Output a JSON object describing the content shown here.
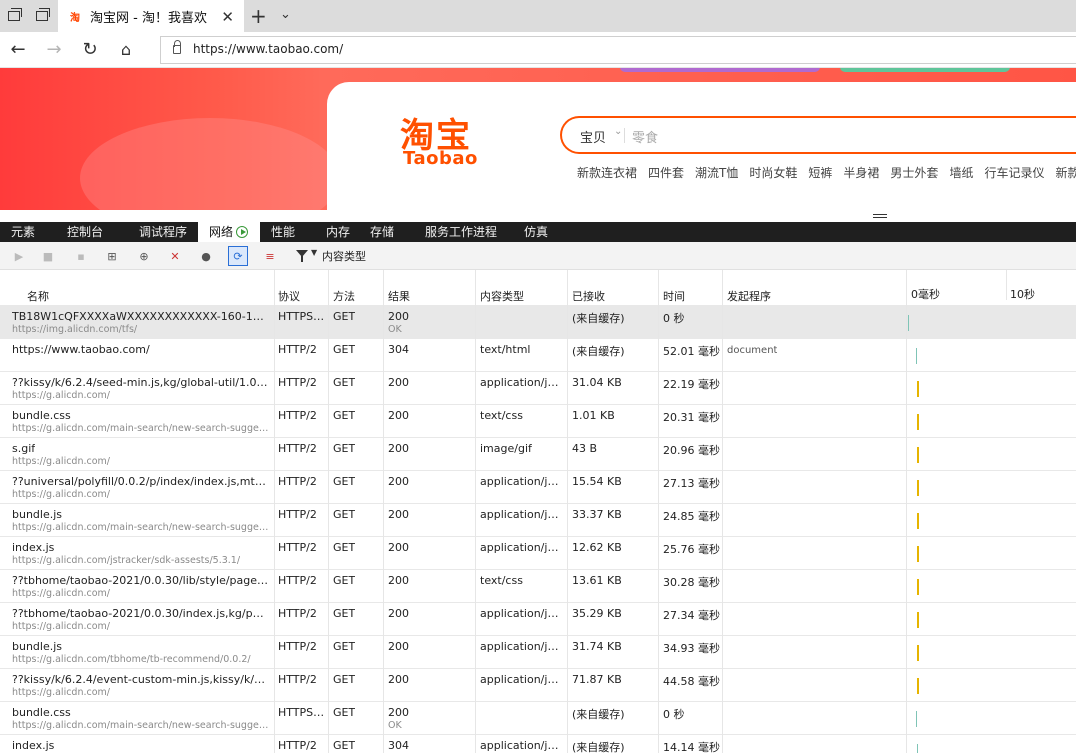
{
  "browser": {
    "tab_title": "淘宝网 - 淘！我喜欢",
    "tab_favicon": "淘",
    "url": "https://www.taobao.com/"
  },
  "page": {
    "logo_cn": "淘宝",
    "logo_en": "Taobao",
    "search_category": "宝贝",
    "search_placeholder": "零食",
    "hotwords": [
      "新款连衣裙",
      "四件套",
      "潮流T恤",
      "时尚女鞋",
      "短裤",
      "半身裙",
      "男士外套",
      "墙纸",
      "行车记录仪",
      "新款男鞋"
    ],
    "brand_color": "#ff5000"
  },
  "devtools": {
    "tabs": [
      "元素",
      "控制台",
      "调试程序",
      "网络",
      "性能",
      "内存",
      "存储",
      "服务工作进程",
      "仿真"
    ],
    "filter_label": "内容类型",
    "columns": {
      "name": "名称",
      "protocol": "协议",
      "method": "方法",
      "result": "结果",
      "content_type": "内容类型",
      "received": "已接收",
      "time": "时间",
      "initiator": "发起程序",
      "wf_0": "0毫秒",
      "wf_10": "10秒"
    },
    "rows": [
      {
        "name": "TB18W1cQFXXXXaWXXXXXXXXXXXX-160-160.png_...",
        "domain": "https://img.alicdn.com/tfs/",
        "protocol": "HTTPS/...",
        "method": "GET",
        "status": "200",
        "status_text": "OK",
        "type": "",
        "received": "(来自缓存)",
        "time": "0 秒",
        "initiator": "",
        "wf_color": "#7fc4b6"
      },
      {
        "name": "https://www.taobao.com/",
        "domain": "",
        "protocol": "HTTP/2",
        "method": "GET",
        "status": "304",
        "status_text": "",
        "type": "text/html",
        "received": "(来自缓存)",
        "time": "52.01 毫秒",
        "initiator": "document",
        "wf_color": "#7fc4b6"
      },
      {
        "name": "??kissy/k/6.2.4/seed-min.js,kg/global-util/1.0.7/inde...",
        "domain": "https://g.alicdn.com/",
        "protocol": "HTTP/2",
        "method": "GET",
        "status": "200",
        "status_text": "",
        "type": "application/java...",
        "received": "31.04 KB",
        "time": "22.19 毫秒",
        "initiator": "",
        "wf_color": "#e6b400"
      },
      {
        "name": "bundle.css",
        "domain": "https://g.alicdn.com/main-search/new-search-suggest/0...",
        "protocol": "HTTP/2",
        "method": "GET",
        "status": "200",
        "status_text": "",
        "type": "text/css",
        "received": "1.01 KB",
        "time": "20.31 毫秒",
        "initiator": "",
        "wf_color": "#e6b400"
      },
      {
        "name": "s.gif",
        "domain": "https://g.alicdn.com/",
        "protocol": "HTTP/2",
        "method": "GET",
        "status": "200",
        "status_text": "",
        "type": "image/gif",
        "received": "43 B",
        "time": "20.96 毫秒",
        "initiator": "",
        "wf_color": "#e6b400"
      },
      {
        "name": "??universal/polyfill/0.0.2/p/index/index.js,mtb/lib-e...",
        "domain": "https://g.alicdn.com/",
        "protocol": "HTTP/2",
        "method": "GET",
        "status": "200",
        "status_text": "",
        "type": "application/java...",
        "received": "15.54 KB",
        "time": "27.13 毫秒",
        "initiator": "",
        "wf_color": "#e6b400"
      },
      {
        "name": "bundle.js",
        "domain": "https://g.alicdn.com/main-search/new-search-suggest/0...",
        "protocol": "HTTP/2",
        "method": "GET",
        "status": "200",
        "status_text": "",
        "type": "application/java...",
        "received": "33.37 KB",
        "time": "24.85 毫秒",
        "initiator": "",
        "wf_color": "#e6b400"
      },
      {
        "name": "index.js",
        "domain": "https://g.alicdn.com/jstracker/sdk-assests/5.3.1/",
        "protocol": "HTTP/2",
        "method": "GET",
        "status": "200",
        "status_text": "",
        "type": "application/java...",
        "received": "12.62 KB",
        "time": "25.76 毫秒",
        "initiator": "",
        "wf_color": "#e6b400"
      },
      {
        "name": "??tbhome/taobao-2021/0.0.30/lib/style/page-min.c...",
        "domain": "https://g.alicdn.com/",
        "protocol": "HTTP/2",
        "method": "GET",
        "status": "200",
        "status_text": "",
        "type": "text/css",
        "received": "13.61 KB",
        "time": "30.28 毫秒",
        "initiator": "",
        "wf_color": "#e6b400"
      },
      {
        "name": "??tbhome/taobao-2021/0.0.30/index.js,kg/pattern/...",
        "domain": "https://g.alicdn.com/",
        "protocol": "HTTP/2",
        "method": "GET",
        "status": "200",
        "status_text": "",
        "type": "application/java...",
        "received": "35.29 KB",
        "time": "27.34 毫秒",
        "initiator": "",
        "wf_color": "#e6b400"
      },
      {
        "name": "bundle.js",
        "domain": "https://g.alicdn.com/tbhome/tb-recommend/0.0.2/",
        "protocol": "HTTP/2",
        "method": "GET",
        "status": "200",
        "status_text": "",
        "type": "application/java...",
        "received": "31.74 KB",
        "time": "34.93 毫秒",
        "initiator": "",
        "wf_color": "#e6b400"
      },
      {
        "name": "??kissy/k/6.2.4/event-custom-min.js,kissy/k/6.2.4/ev...",
        "domain": "https://g.alicdn.com/",
        "protocol": "HTTP/2",
        "method": "GET",
        "status": "200",
        "status_text": "",
        "type": "application/java...",
        "received": "71.87 KB",
        "time": "44.58 毫秒",
        "initiator": "",
        "wf_color": "#e6b400"
      },
      {
        "name": "bundle.css",
        "domain": "https://g.alicdn.com/main-search/new-search-suggest/0...",
        "protocol": "HTTPS/...",
        "method": "GET",
        "status": "200",
        "status_text": "OK",
        "type": "",
        "received": "(来自缓存)",
        "time": "0 秒",
        "initiator": "",
        "wf_color": "#7fc4b6"
      },
      {
        "name": "index.js",
        "domain": "",
        "protocol": "HTTP/2",
        "method": "GET",
        "status": "304",
        "status_text": "",
        "type": "application/java...",
        "received": "(来自缓存)",
        "time": "14.14 毫秒",
        "initiator": "",
        "wf_color": "#7fc4b6"
      }
    ]
  }
}
